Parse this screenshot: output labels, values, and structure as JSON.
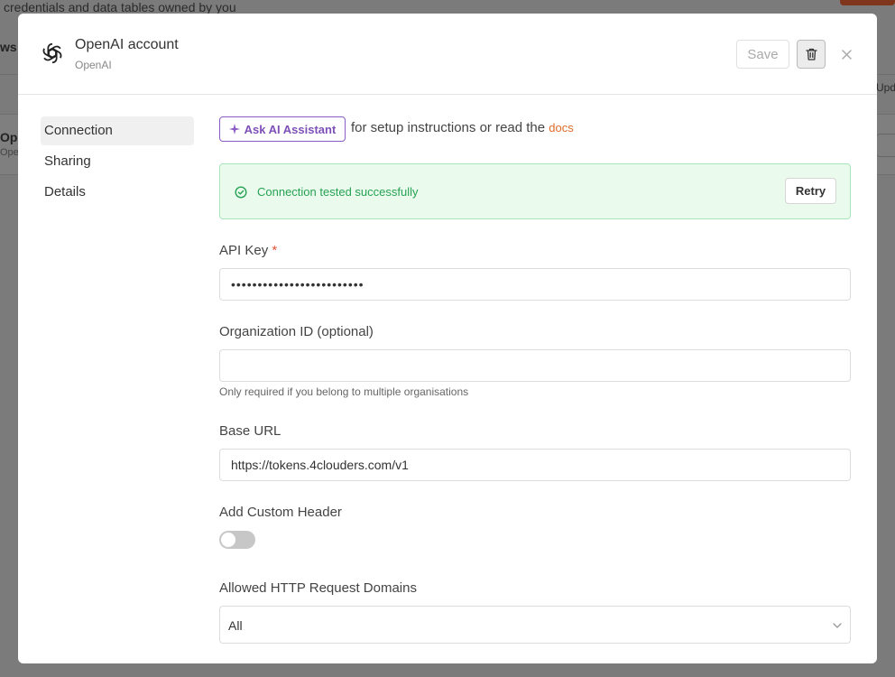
{
  "background": {
    "subtitle": "credentials and data tables owned by you",
    "ws_label": "ws",
    "column_label": "Update",
    "row_name": "OpenAI",
    "row_sub": "OpenAI"
  },
  "modal": {
    "title": "OpenAI account",
    "subtitle": "OpenAI",
    "save_label": "Save",
    "logo_icon": "openai-logo-icon",
    "trash_icon": "trash-icon",
    "close_icon": "close-icon"
  },
  "sidebar": {
    "items": [
      {
        "label": "Connection",
        "active": true
      },
      {
        "label": "Sharing",
        "active": false
      },
      {
        "label": "Details",
        "active": false
      }
    ]
  },
  "assistant": {
    "button_label": "Ask AI Assistant",
    "text": "for setup instructions or read the",
    "docs_label": "docs",
    "accent": "#7d50b8"
  },
  "status": {
    "message": "Connection tested successfully",
    "retry_label": "Retry",
    "color": "#27a153"
  },
  "fields": {
    "api_key": {
      "label": "API Key",
      "required_mark": "*",
      "value": "•••••••••••••••••••••••••"
    },
    "org_id": {
      "label": "Organization ID (optional)",
      "value": "",
      "hint": "Only required if you belong to multiple organisations"
    },
    "base_url": {
      "label": "Base URL",
      "value": "https://tokens.4clouders.com/v1"
    },
    "custom_header": {
      "label": "Add Custom Header",
      "enabled": false
    },
    "allowed_domains": {
      "label": "Allowed HTTP Request Domains",
      "value": "All"
    }
  }
}
